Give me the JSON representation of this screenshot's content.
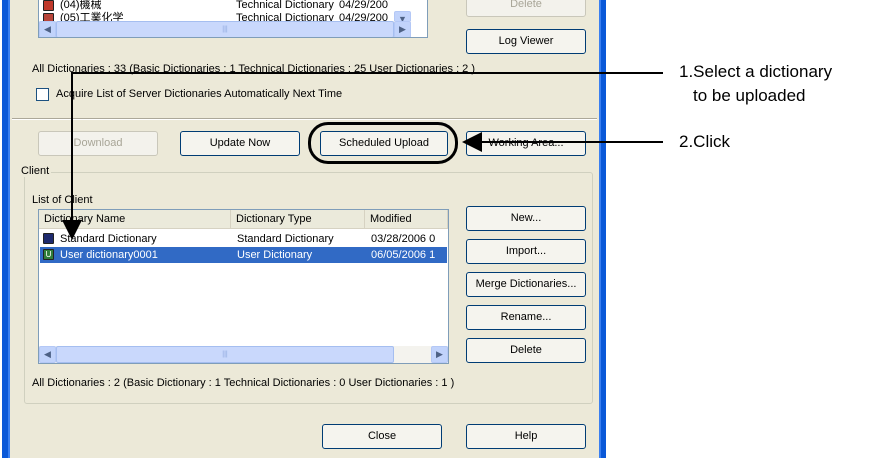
{
  "server_list": {
    "rows": [
      {
        "name": "(04)機械",
        "type": "Technical Dictionary",
        "modified": "04/29/200"
      },
      {
        "name": "(05)工業化学",
        "type": "Technical Dictionary",
        "modified": "04/29/200"
      }
    ],
    "summary": "All Dictionaries : 33    (Basic Dictionaries : 1  Technical Dictionaries : 25  User Dictionaries : 2  )"
  },
  "buttons": {
    "delete_top": "Delete",
    "log_viewer": "Log Viewer",
    "download": "Download",
    "update_now": "Update Now",
    "scheduled_upload": "Scheduled Upload",
    "working_area": "Working Area...",
    "new": "New...",
    "import": "Import...",
    "merge": "Merge Dictionaries...",
    "rename": "Rename...",
    "delete": "Delete",
    "close": "Close",
    "help": "Help"
  },
  "checkbox": {
    "label": "Acquire List of Server Dictionaries Automatically Next Time",
    "checked": false
  },
  "client": {
    "group_label": "Client",
    "list_label": "List of Client",
    "columns": [
      "Dictionary Name",
      "Dictionary Type",
      "Modified"
    ],
    "rows": [
      {
        "name": "Standard Dictionary",
        "type": "Standard Dictionary",
        "modified": "03/28/2006 0",
        "icon": "standard-dictionary-icon",
        "selected": false
      },
      {
        "name": "User dictionary0001",
        "type": "User Dictionary",
        "modified": "06/05/2006 1",
        "icon": "user-dictionary-icon",
        "selected": true
      }
    ],
    "summary": "All Dictionaries :  2     (Basic Dictionary : 1  Technical Dictionaries :  0    User Dictionaries :  1     )"
  },
  "annotations": {
    "step1_line1": "1.Select a dictionary",
    "step1_line2": "to be uploaded",
    "step2": "2.Click"
  },
  "colors": {
    "selection": "#316ac5",
    "dialog_bg": "#ece9d8",
    "window_border": "#0a58d8"
  }
}
